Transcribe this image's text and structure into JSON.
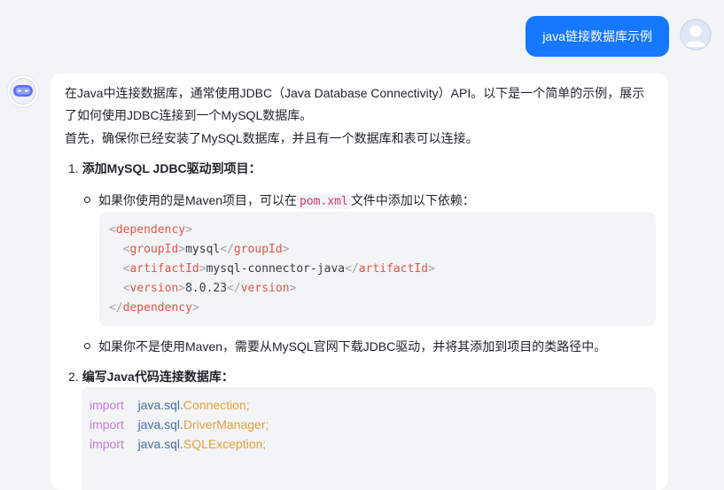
{
  "user_message": {
    "text": "java链接数据库示例"
  },
  "answer": {
    "para1_line1": "在Java中连接数据库，通常使用JDBC（Java Database Connectivity）API。以下是一个简单的示例，展示",
    "para1_line2": "了如何使用JDBC连接到一个MySQL数据库。",
    "para2": "首先，确保你已经安装了MySQL数据库，并且有一个数据库和表可以连接。",
    "step1": {
      "num": "1.",
      "title": "添加MySQL JDBC驱动到项目："
    },
    "step1_bullet1": {
      "before": "如果你使用的是Maven项目，可以在",
      "code": "pom.xml",
      "after": "文件中添加以下依赖："
    },
    "xml_code": {
      "dependency": "dependency",
      "groupId": "groupId",
      "groupId_value": "mysql",
      "artifactId": "artifactId",
      "artifactId_value": "mysql-connector-java",
      "version": "version",
      "version_value": "8.0.23"
    },
    "step1_bullet2": "如果你不是使用Maven，需要从MySQL官网下载JDBC驱动，并将其添加到项目的类路径中。",
    "step2": {
      "num": "2.",
      "title": "编写Java代码连接数据库："
    },
    "java_code": [
      {
        "keyword": "import",
        "pkg": "java.sql.",
        "cls": "Connection;"
      },
      {
        "keyword": "import",
        "pkg": "java.sql.",
        "cls": "DriverManager;"
      },
      {
        "keyword": "import",
        "pkg": "java.sql.",
        "cls": "SQLException;"
      }
    ]
  },
  "colors": {
    "accent": "#1677ff",
    "background": "#f3f4f7",
    "code_bg": "#f3f4f6"
  }
}
